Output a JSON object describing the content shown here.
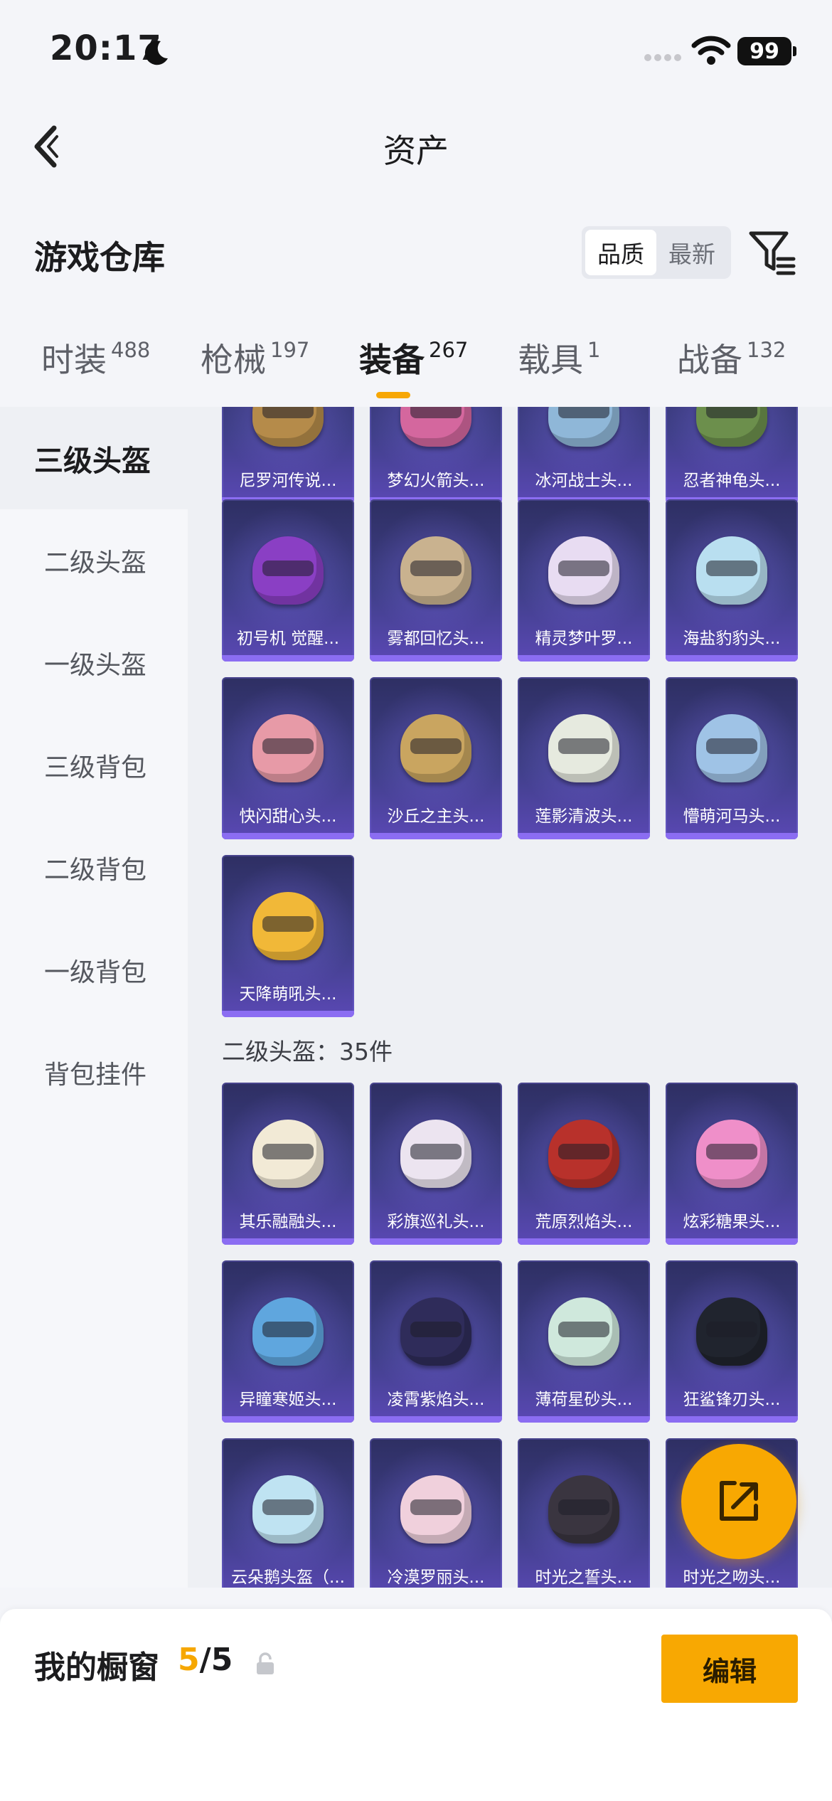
{
  "status_bar": {
    "time": "20:17",
    "battery": "99"
  },
  "nav": {
    "title": "资产"
  },
  "warehouse": {
    "title": "游戏仓库",
    "sort_options": [
      "品质",
      "最新"
    ]
  },
  "tabs": [
    {
      "label": "时装",
      "count": "488"
    },
    {
      "label": "枪械",
      "count": "197"
    },
    {
      "label": "装备",
      "count": "267"
    },
    {
      "label": "载具",
      "count": "1"
    },
    {
      "label": "战备",
      "count": "132"
    }
  ],
  "sidebar": {
    "items": [
      "三级头盔",
      "二级头盔",
      "一级头盔",
      "三级背包",
      "二级背包",
      "一级背包",
      "背包挂件"
    ]
  },
  "grid": {
    "level3_items": [
      {
        "name": "尼罗河传说...",
        "color": "#b58b4a"
      },
      {
        "name": "梦幻火箭头...",
        "color": "#d4679e"
      },
      {
        "name": "冰河战士头...",
        "color": "#8fb7d8"
      },
      {
        "name": "忍者神龟头...",
        "color": "#6c8f4c"
      },
      {
        "name": "初号机 觉醒...",
        "color": "#8a3fc4"
      },
      {
        "name": "雾都回忆头...",
        "color": "#c9b28f"
      },
      {
        "name": "精灵梦叶罗...",
        "color": "#e8dcf2"
      },
      {
        "name": "海盐豹豹头...",
        "color": "#b9dff0"
      },
      {
        "name": "快闪甜心头...",
        "color": "#e79aa7"
      },
      {
        "name": "沙丘之主头...",
        "color": "#c9a560"
      },
      {
        "name": "莲影清波头...",
        "color": "#e6eadf"
      },
      {
        "name": "懵萌河马头...",
        "color": "#9fc3e6"
      },
      {
        "name": "天降萌吼头...",
        "color": "#f1b838"
      }
    ],
    "level2_title": "二级头盔：35件",
    "level2_items": [
      {
        "name": "其乐融融头...",
        "color": "#f2ead6"
      },
      {
        "name": "彩旗巡礼头...",
        "color": "#ece4f0"
      },
      {
        "name": "荒原烈焰头...",
        "color": "#b8312b"
      },
      {
        "name": "炫彩糖果头...",
        "color": "#ef8fc9"
      },
      {
        "name": "异瞳寒姬头...",
        "color": "#5fa6de"
      },
      {
        "name": "凌霄紫焰头...",
        "color": "#2f2c5a"
      },
      {
        "name": "薄荷星砂头...",
        "color": "#cfe8dc"
      },
      {
        "name": "狂鲨锋刃头...",
        "color": "#20242e"
      },
      {
        "name": "云朵鹅头盔（...",
        "color": "#bfe3f2"
      },
      {
        "name": "冷漠罗丽头...",
        "color": "#f0d0dc"
      },
      {
        "name": "时光之誓头...",
        "color": "#3a3540"
      },
      {
        "name": "时光之吻头...",
        "color": "#4a3f50"
      }
    ]
  },
  "bottom_bar": {
    "showcase_label": "我的橱窗",
    "showcase_current": "5",
    "showcase_total": "/5",
    "edit_label": "编辑"
  },
  "colors": {
    "accent": "#f8a802",
    "card_bg": "#3f3f88"
  }
}
